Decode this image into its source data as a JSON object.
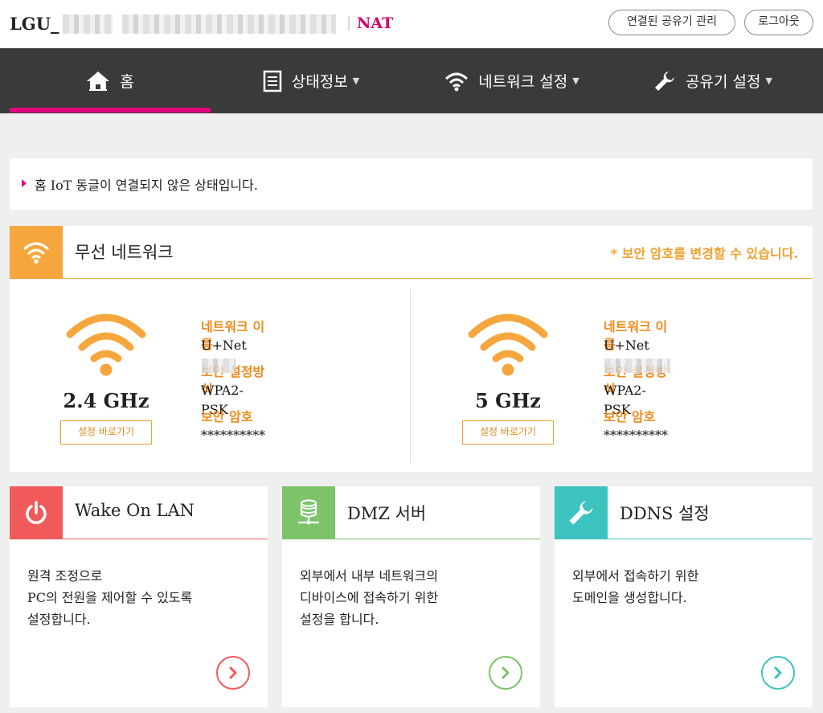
{
  "header": {
    "brand": "LGU_",
    "nat": "NAT",
    "sep": "|",
    "manage_button": "연결된 공유기 관리",
    "logout_button": "로그아웃"
  },
  "nav": {
    "items": [
      {
        "label": "홈",
        "icon": "home-icon"
      },
      {
        "label": "상태정보",
        "icon": "document-icon"
      },
      {
        "label": "네트워크 설정",
        "icon": "wifi-icon"
      },
      {
        "label": "공유기 설정",
        "icon": "wrench-icon"
      }
    ],
    "caret": "▼"
  },
  "notice": {
    "text": "홈 IoT 동글이 연결되지 않은 상태입니다."
  },
  "wireless": {
    "title": "무선 네트워크",
    "hint": "* 보안 암호를 변경할 수 있습니다.",
    "bands": [
      {
        "freq": "2.4 GHz",
        "goto": "설정 바로가기",
        "name_label": "네트워크 이름",
        "name_value": "U+Net",
        "security_label": "보안 설정방식",
        "security_value": "WPA2-PSK",
        "password_label": "보안 암호",
        "password_value": "**********"
      },
      {
        "freq": "5 GHz",
        "goto": "설정 바로가기",
        "name_label": "네트워크 이름",
        "name_value": "U+Net",
        "security_label": "보안 설정방식",
        "security_value": "WPA2-PSK",
        "password_label": "보안 암호",
        "password_value": "**********"
      }
    ]
  },
  "cards": [
    {
      "title": "Wake On LAN",
      "desc": "원격 조정으로\nPC의 전원을 제어할 수 있도록\n설정합니다.",
      "icon": "power-icon",
      "color": "#f05a5a"
    },
    {
      "title": "DMZ 서버",
      "desc": "외부에서 내부 네트워크의\n디바이스에 접속하기 위한\n설정을 합니다.",
      "icon": "server-icon",
      "color": "#7cc36a"
    },
    {
      "title": "DDNS 설정",
      "desc": "외부에서 접속하기 위한\n도메인을 생성합니다.",
      "icon": "wrench-icon",
      "color": "#3cc3bf"
    }
  ],
  "colors": {
    "accent": "#e4007f",
    "wireless": "#f5a73d",
    "nav_bg": "#3a3a3a"
  }
}
